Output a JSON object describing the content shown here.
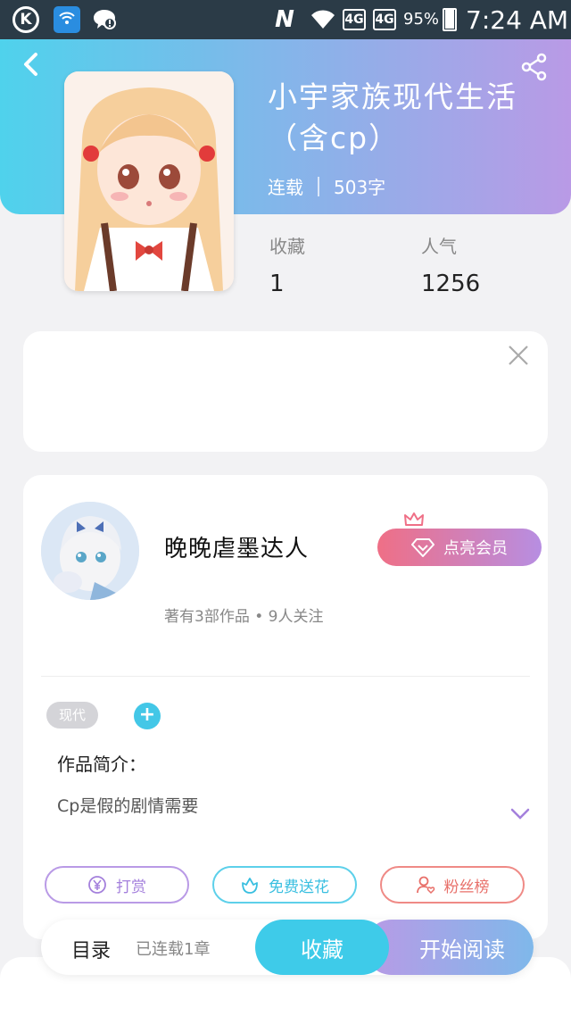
{
  "status_bar": {
    "k_icon": "K",
    "wifi_icon": "wifi-hotspot",
    "n_icon": "N",
    "sim1": "4G",
    "sim2": "4G",
    "battery": "95%",
    "battery_level": 0.95,
    "time": "7:24 AM"
  },
  "book": {
    "title": "小宇家族现代生活（含cp）",
    "status": "连载",
    "word_count": "503字",
    "favorites_label": "收藏",
    "favorites_value": "1",
    "popularity_label": "人气",
    "popularity_value": "1256"
  },
  "author": {
    "name": "晚晚虐墨达人",
    "stats": "著有3部作品 • 9人关注",
    "vip_label": "点亮会员"
  },
  "tags": [
    "现代"
  ],
  "add_tag": "+",
  "intro": {
    "label": "作品简介：",
    "text": "Cp是假的剧情需要"
  },
  "actions": {
    "reward": "打赏",
    "flower": "免费送花",
    "fans": "粉丝榜"
  },
  "bottom_bar": {
    "toc": "目录",
    "chapters": "已连载1章",
    "favorite": "收藏",
    "read": "开始阅读"
  },
  "colors": {
    "header_gradient_start": "#4fd2ec",
    "header_gradient_end": "#b99ae6",
    "accent_cyan": "#3ecbe9",
    "accent_purple": "#b99ae6",
    "accent_red": "#ef6f86"
  }
}
